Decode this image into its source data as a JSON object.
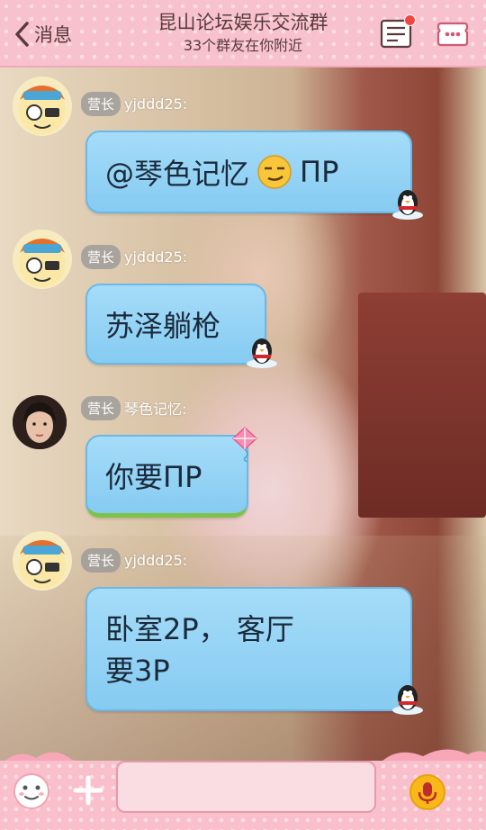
{
  "header": {
    "back_label": "消息",
    "title": "昆山论坛娱乐交流群",
    "subtitle": "33个群友在你附近"
  },
  "messages": [
    {
      "role_badge": "营长",
      "sender": "yjddd25:",
      "text_before": "@琴色记忆",
      "emoji": "smirk-emoji",
      "text_after": "ΠP"
    },
    {
      "role_badge": "营长",
      "sender": "yjddd25:",
      "text": "苏泽躺枪"
    },
    {
      "role_badge": "营长",
      "sender": "琴色记忆:",
      "text": "你要ΠP"
    },
    {
      "role_badge": "营长",
      "sender": "yjddd25:",
      "text_line1": "卧室2P， 客厅",
      "text_line2": "要3P"
    }
  ],
  "input": {
    "value": "",
    "placeholder": ""
  },
  "colors": {
    "header_bg": "#f7c2cd",
    "bubble": "#a5dcf8",
    "bubble_border": "#6bb8e6",
    "voice_button": "#f8b818",
    "notification_dot": "#f0463f"
  },
  "icons": [
    "back-chevron-icon",
    "members-list-icon",
    "more-icon",
    "emoji-face-icon",
    "plus-icon",
    "microphone-icon",
    "penguin-icon",
    "kite-icon"
  ]
}
